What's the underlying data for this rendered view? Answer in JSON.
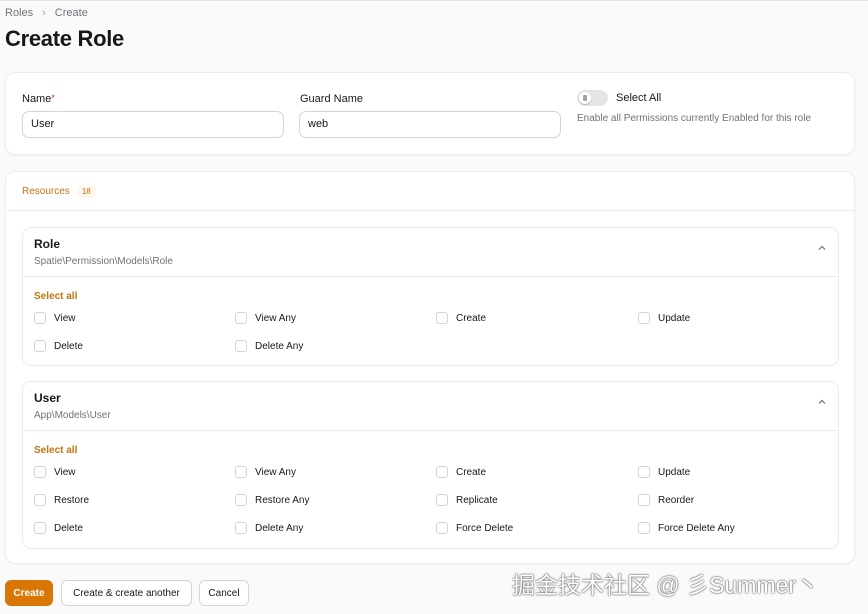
{
  "breadcrumb": [
    "Roles",
    "Create"
  ],
  "breadcrumb_sep": "›",
  "page_title": "Create Role",
  "form": {
    "name_label": "Name",
    "required_marker": "*",
    "name_value": "User",
    "guard_label": "Guard Name",
    "guard_value": "web",
    "select_all_label": "Select All",
    "select_all_enabled": false,
    "select_all_helper": "Enable all Permissions currently Enabled for this role"
  },
  "tabs": [
    {
      "label": "Resources",
      "count": "18"
    }
  ],
  "sections": [
    {
      "title": "Role",
      "subtitle": "Spatie\\Permission\\Models\\Role",
      "select_all": "Select all",
      "permissions": [
        "View",
        "View Any",
        "Create",
        "Update",
        "Delete",
        "Delete Any"
      ]
    },
    {
      "title": "User",
      "subtitle": "App\\Models\\User",
      "select_all": "Select all",
      "permissions": [
        "View",
        "View Any",
        "Create",
        "Update",
        "Restore",
        "Restore Any",
        "Replicate",
        "Reorder",
        "Delete",
        "Delete Any",
        "Force Delete",
        "Force Delete Any"
      ]
    }
  ],
  "actions": {
    "create": "Create",
    "create_another": "Create & create another",
    "cancel": "Cancel"
  },
  "watermark": "掘金技术社区 @ 彡Summer丶",
  "colors": {
    "accent": "#d97706",
    "accent_text": "#c2740c"
  }
}
